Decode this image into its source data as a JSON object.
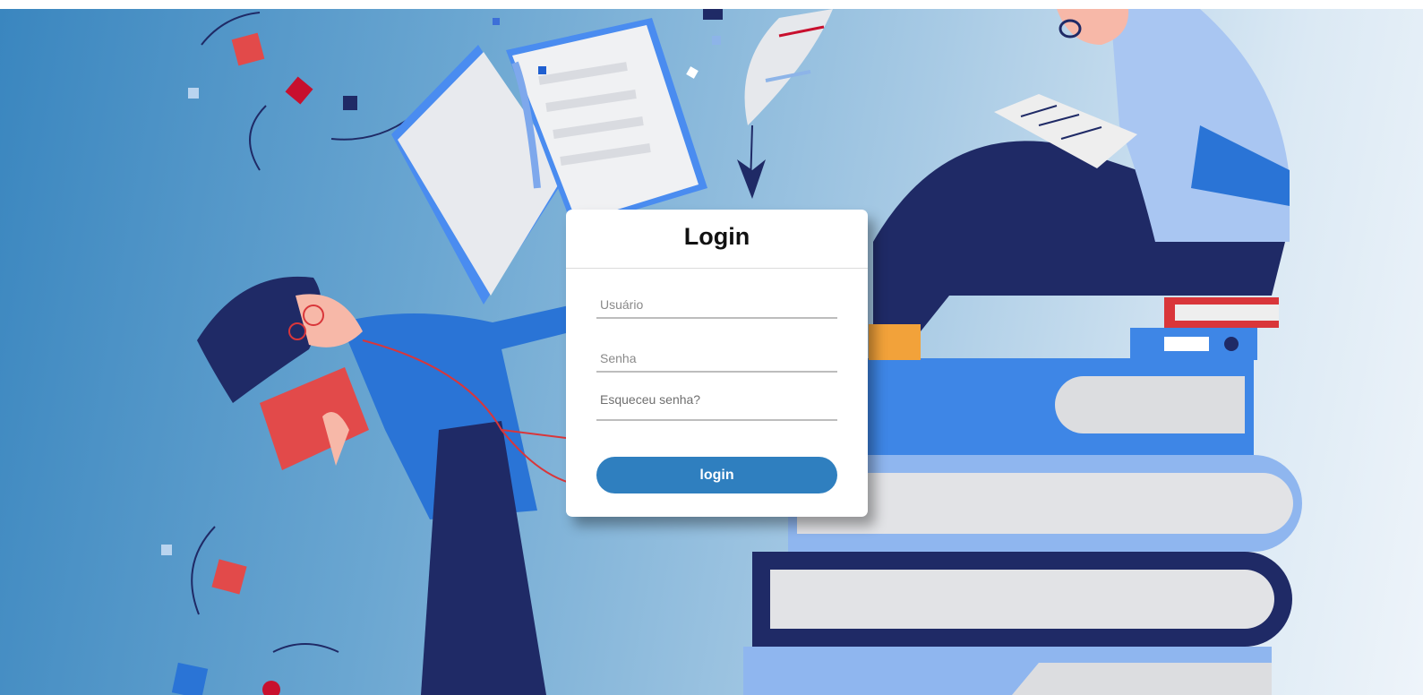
{
  "login": {
    "title": "Login",
    "username_placeholder": "Usuário",
    "password_placeholder": "Senha",
    "forgot_password": "Esqueceu senha?",
    "submit_label": "login"
  },
  "colors": {
    "button": "#2f7fbf",
    "background_start": "#3a86bf",
    "background_end": "#eef4fa"
  }
}
